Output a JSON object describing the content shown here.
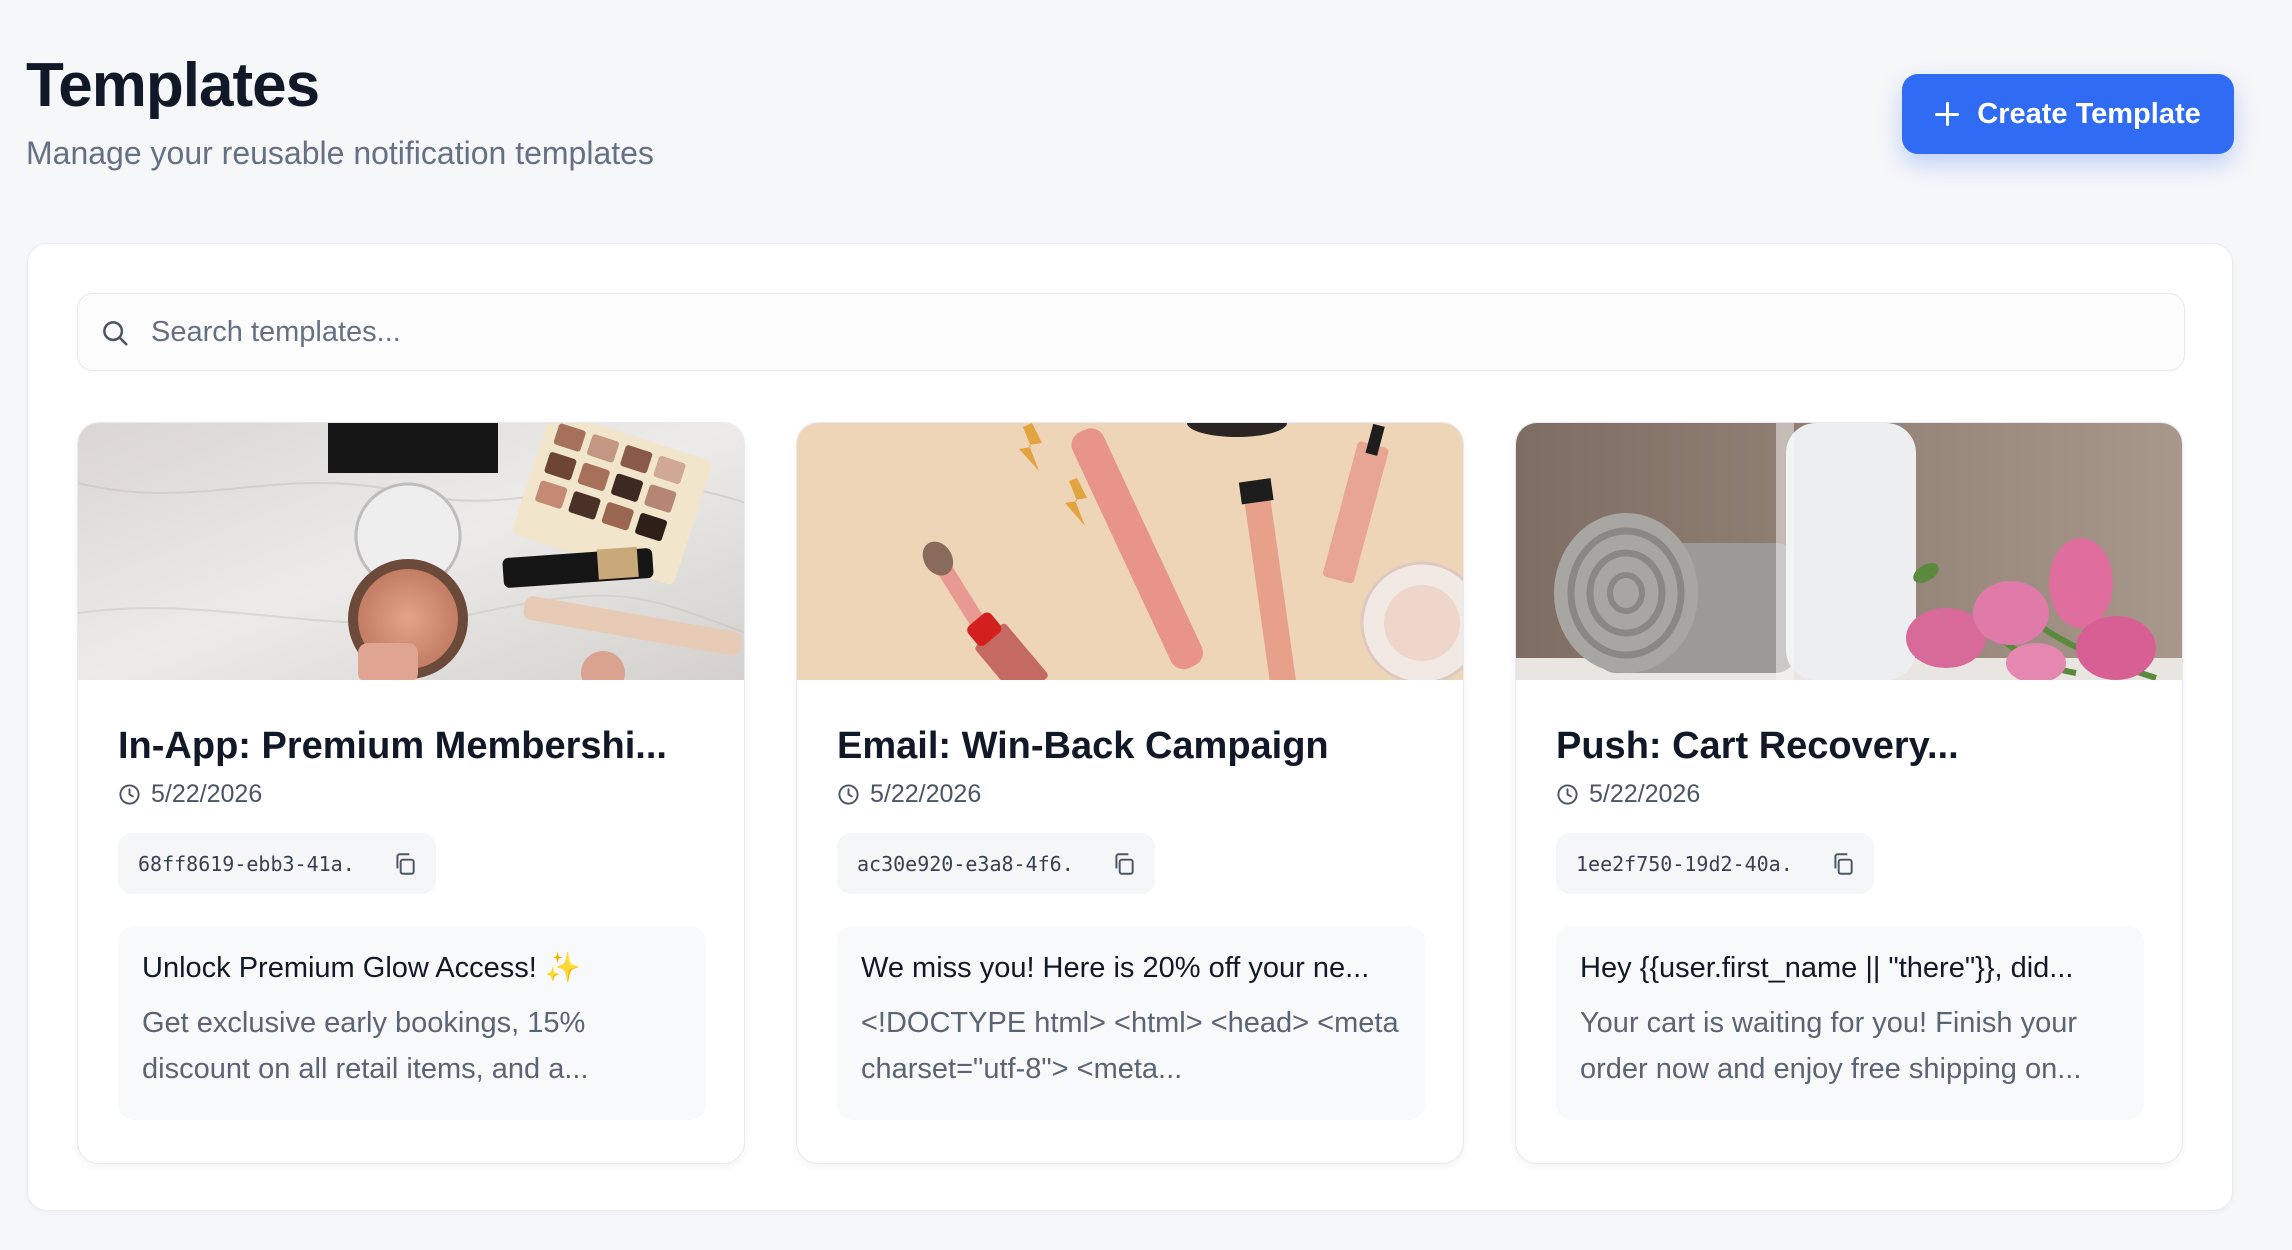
{
  "header": {
    "title": "Templates",
    "subtitle": "Manage your reusable notification templates",
    "create_label": "Create Template"
  },
  "search": {
    "placeholder": "Search templates..."
  },
  "templates": [
    {
      "title": "In-App: Premium Membershi...",
      "date": "5/22/2026",
      "id": "68ff8619-ebb3-41a...",
      "preview_title": "Unlock Premium Glow Access! ✨",
      "preview_body": "Get exclusive early bookings, 15% discount on all retail items, and a...",
      "image": "makeup-palette-compact-lipstick-on-marble"
    },
    {
      "title": "Email: Win-Back Campaign",
      "date": "5/22/2026",
      "id": "ac30e920-e3a8-4f6...",
      "preview_title": "We miss you! Here is 20% off your ne...",
      "preview_body": "<!DOCTYPE html> <html> <head> <meta charset=\"utf-8\"> <meta...",
      "image": "pink-cosmetics-brushes-on-peach"
    },
    {
      "title": "Push: Cart Recovery...",
      "date": "5/22/2026",
      "id": "1ee2f750-19d2-40a...",
      "preview_title": "Hey {{user.first_name || \"there\"}}, did...",
      "preview_body": "Your cart is waiting for you! Finish your order now and enjoy free shipping on...",
      "image": "rolled-towel-bottle-pink-tulips"
    }
  ],
  "icons": {
    "create": "plus-icon",
    "search": "search-icon",
    "date": "clock-icon",
    "copy": "copy-icon"
  },
  "colors": {
    "accent": "#2f6bf3",
    "background": "#f6f7f9",
    "card": "#ffffff",
    "text": "#111827",
    "muted": "#667085"
  }
}
